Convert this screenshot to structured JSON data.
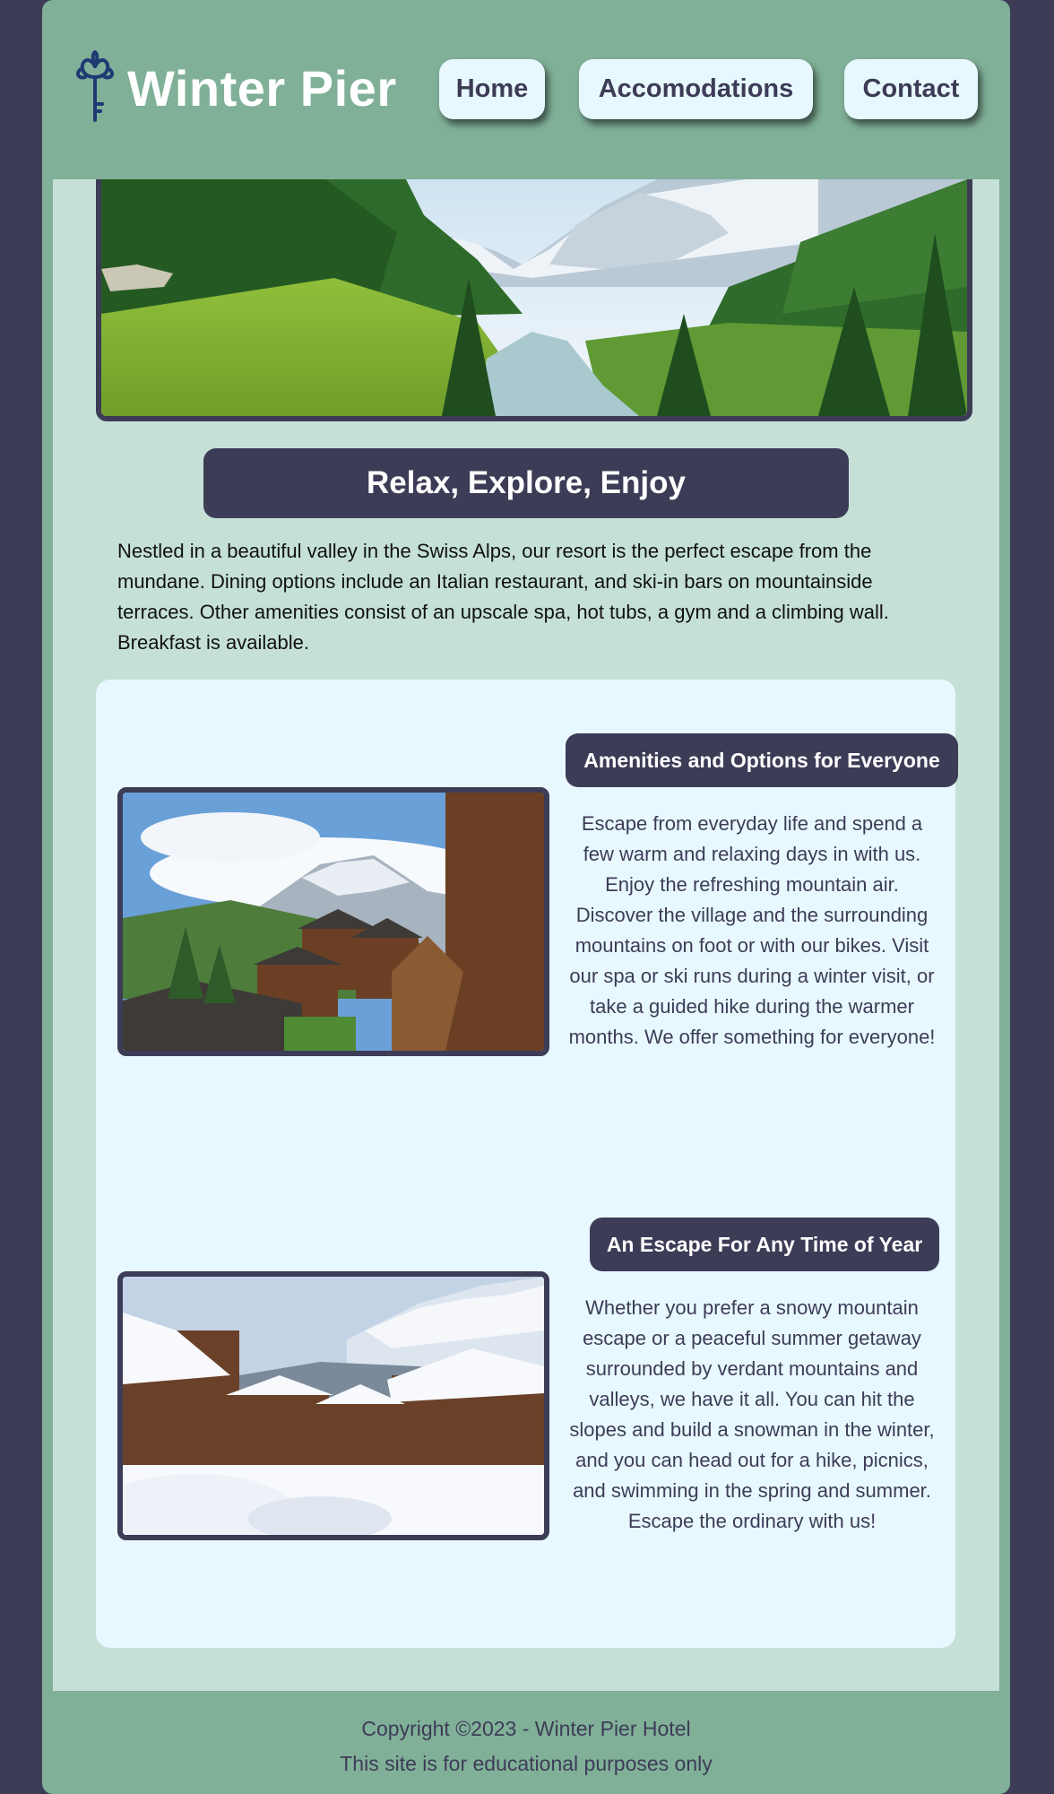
{
  "header": {
    "site_title": "Winter Pier",
    "logo_icon": "key-icon",
    "nav": [
      {
        "label": "Home"
      },
      {
        "label": "Accomodations"
      },
      {
        "label": "Contact"
      }
    ]
  },
  "hero": {
    "image": "alpine-valley-river-photo"
  },
  "main": {
    "tagline": "Relax, Explore, Enjoy",
    "intro": "Nestled in a beautiful valley in the Swiss Alps, our resort is the perfect escape from the mundane. Dining options include an Italian restaurant, and ski-in bars on mountainside terraces. Other amenities consist of an upscale spa, hot tubs, a gym and a climbing wall. Breakfast is available."
  },
  "sections": [
    {
      "title": "Amenities and Options for Everyone",
      "text": "Escape from everyday life and spend a few warm and relaxing days in with us. Enjoy the refreshing mountain air. Discover the village and the surrounding mountains on foot or with our bikes. Visit our spa or ski runs during a winter visit, or take a guided hike during the warmer months. We offer something for everyone!",
      "image": "summer-alpine-village-photo"
    },
    {
      "title": "An Escape For Any Time of Year",
      "text": "Whether you prefer a snowy mountain escape or a peaceful summer getaway surrounded by verdant mountains and valleys, we have it all. You can hit the slopes and build a snowman in the winter, and you can head out for a hike, picnics, and swimming in the spring and summer. Escape the ordinary with us!",
      "image": "winter-snowy-village-photo"
    }
  ],
  "footer": {
    "copyright": "Copyright ©2023 - Winter Pier Hotel",
    "note": "This site is for educational purposes only"
  },
  "colors": {
    "navy": "#3d3c57",
    "sage": "#80b098",
    "mint": "#c5e1d7",
    "ice": "#e8f8ff"
  }
}
